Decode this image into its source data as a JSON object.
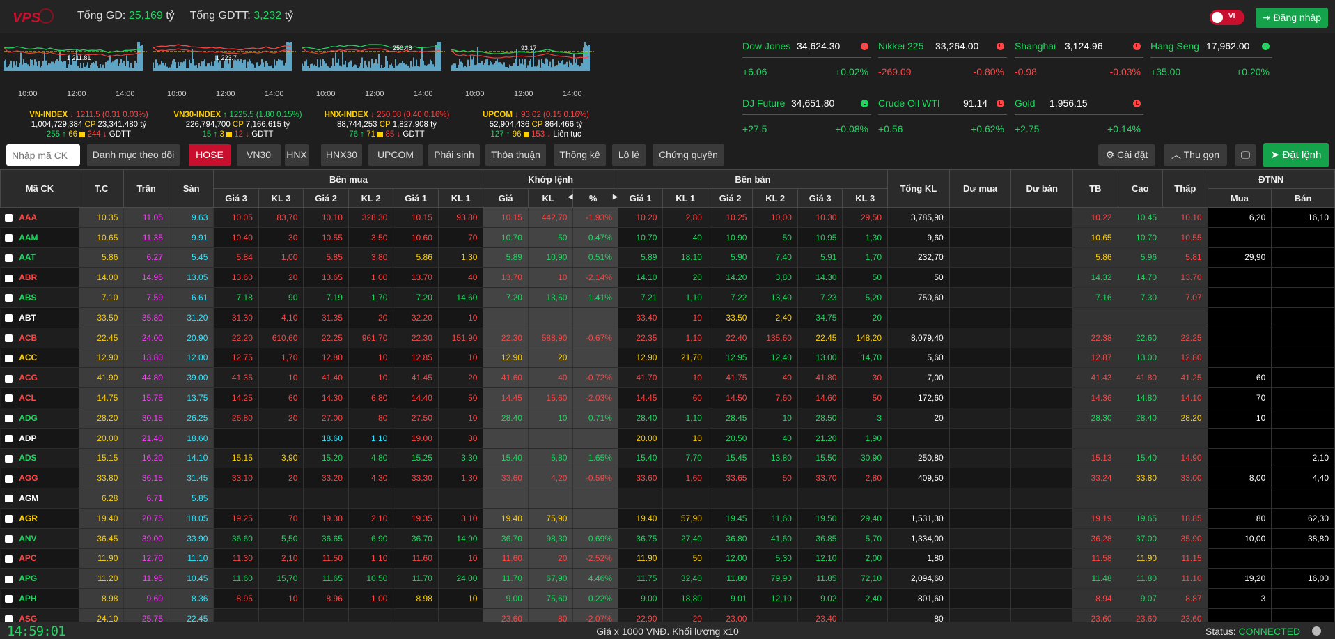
{
  "header": {
    "logo_text": "VPS",
    "total_gd_label": "Tổng GD:",
    "total_gd_value": "25,169",
    "total_gd_unit": "tỷ",
    "total_gdtt_label": "Tổng GDTT:",
    "total_gdtt_value": "3,232",
    "total_gdtt_unit": "tỷ",
    "lang_label": "VI",
    "login_label": "Đăng nhập"
  },
  "indices": [
    {
      "name": "VN-INDEX",
      "value": "1211.5",
      "change": "(0.31  0.03%)",
      "volume": "1,004,729,384",
      "cp_value": "23,341.480 tỷ",
      "up": "255",
      "ref": "66",
      "down": "244",
      "tail": "GDTT",
      "ref_label": "1 211.81",
      "dir": "down",
      "times": [
        "10:00",
        "12:00",
        "14:00"
      ]
    },
    {
      "name": "VN30-INDEX",
      "value": "1225.5",
      "change": "(1.80  0.15%)",
      "volume": "226,794,700",
      "cp_value": "7,166.615 tỷ",
      "up": "15",
      "ref": "3",
      "down": "12",
      "tail": "GDTT",
      "ref_label": "1 223.7",
      "dir": "up",
      "times": [
        "10:00",
        "12:00",
        "14:00"
      ]
    },
    {
      "name": "HNX-INDEX",
      "value": "250.08",
      "change": "(0.40  0.16%)",
      "volume": "88,744,253",
      "cp_value": "1,827.908 tỷ",
      "up": "76",
      "ref": "71",
      "down": "85",
      "tail": "GDTT",
      "ref_label": "250.48",
      "dir": "down",
      "times": [
        "10:00",
        "12:00",
        "14:00"
      ]
    },
    {
      "name": "UPCOM",
      "value": "93.02",
      "change": "(0.15  0.16%)",
      "volume": "52,904,436",
      "cp_value": "864.466 tỷ",
      "up": "127",
      "ref": "96",
      "down": "153",
      "tail": "Liên tục",
      "ref_label": "93.17",
      "dir": "down",
      "times": [
        "10:00",
        "12:00",
        "14:00"
      ]
    }
  ],
  "world": [
    {
      "name": "Dow Jones",
      "value": "34,624.30",
      "change": "+6.06",
      "pct": "+0.02%",
      "color": "#1ed760",
      "clock": "#ff4545"
    },
    {
      "name": "Nikkei 225",
      "value": "33,264.00",
      "change": "-269.09",
      "pct": "-0.80%",
      "color": "#ff4545",
      "clock": "#ff4545"
    },
    {
      "name": "Shanghai",
      "value": "3,124.96",
      "change": "-0.98",
      "pct": "-0.03%",
      "color": "#ff4545",
      "clock": "#ff4545"
    },
    {
      "name": "Hang Seng",
      "value": "17,962.00",
      "change": "+35.00",
      "pct": "+0.20%",
      "color": "#1ed760",
      "clock": "#1ed760"
    },
    {
      "name": "DJ Future",
      "value": "34,651.80",
      "change": "+27.5",
      "pct": "+0.08%",
      "color": "#1ed760",
      "clock": "#1ed760"
    },
    {
      "name": "Crude Oil WTI",
      "value": "91.14",
      "change": "+0.56",
      "pct": "+0.62%",
      "color": "#1ed760",
      "clock": "#ff4545"
    },
    {
      "name": "Gold",
      "value": "1,956.15",
      "change": "+2.75",
      "pct": "+0.14%",
      "color": "#1ed760",
      "clock": "#ff4545"
    }
  ],
  "toolbar": {
    "search_placeholder": "Nhập mã CK",
    "tabs": [
      "Danh mục theo dõi",
      "HOSE",
      "VN30",
      "HNX",
      "HNX30",
      "UPCOM",
      "Phái sinh",
      "Thỏa thuận",
      "Thống kê",
      "Lô lẻ",
      "Chứng quyền"
    ],
    "active_tab": "HOSE",
    "settings_label": "Cài đặt",
    "collapse_label": "Thu gọn",
    "order_label": "Đặt lệnh"
  },
  "table": {
    "group_headers": {
      "buy": "Bên mua",
      "match": "Khớp lệnh",
      "sell": "Bên bán",
      "foreign": "ĐTNN"
    },
    "headers": {
      "symbol": "Mã CK",
      "ref": "T.C",
      "ceil": "Trần",
      "floor": "Sàn",
      "b3": "Giá 3",
      "bv3": "KL 3",
      "b2": "Giá 2",
      "bv2": "KL 2",
      "b1": "Giá 1",
      "bv1": "KL 1",
      "mp": "Giá",
      "mv": "KL",
      "pct": "%",
      "s1": "Giá 1",
      "sv1": "KL 1",
      "s2": "Giá 2",
      "sv2": "KL 2",
      "s3": "Giá 3",
      "sv3": "KL 3",
      "total": "Tổng KL",
      "dbuy": "Dư mua",
      "dsell": "Dư bán",
      "avg": "TB",
      "high": "Cao",
      "low": "Thấp",
      "fbuy": "Mua",
      "fsell": "Bán"
    },
    "rows": [
      {
        "s": "AAA",
        "r": "10.35",
        "c": "11.05",
        "f": "9.63",
        "b3": "10.05",
        "bv3": "83,70",
        "b2": "10.10",
        "bv2": "328,30",
        "b1": "10.15",
        "bv1": "93,80",
        "mp": "10.15",
        "mv": "442,70",
        "pct": "-1.93%",
        "s1": "10.20",
        "sv1": "2,80",
        "s2": "10.25",
        "sv2": "10,00",
        "s3": "10.30",
        "sv3": "29,50",
        "tot": "3,785,90",
        "db": "",
        "ds": "",
        "avg": "10.22",
        "hi": "10.45",
        "lo": "10.10",
        "fb": "6,20",
        "fs": "16,10"
      },
      {
        "s": "AAM",
        "r": "10.65",
        "c": "11.35",
        "f": "9.91",
        "b3": "10.40",
        "bv3": "30",
        "b2": "10.55",
        "bv2": "3,50",
        "b1": "10.60",
        "bv1": "70",
        "mp": "10.70",
        "mv": "50",
        "pct": "0.47%",
        "s1": "10.70",
        "sv1": "40",
        "s2": "10.90",
        "sv2": "50",
        "s3": "10.95",
        "sv3": "1,30",
        "tot": "9,60",
        "db": "",
        "ds": "",
        "avg": "10.65",
        "hi": "10.70",
        "lo": "10.55",
        "fb": "",
        "fs": ""
      },
      {
        "s": "AAT",
        "r": "5.86",
        "c": "6.27",
        "f": "5.45",
        "b3": "5.84",
        "bv3": "1,00",
        "b2": "5.85",
        "bv2": "3,80",
        "b1": "5.86",
        "bv1": "1,30",
        "mp": "5.89",
        "mv": "10,90",
        "pct": "0.51%",
        "s1": "5.89",
        "sv1": "18,10",
        "s2": "5.90",
        "sv2": "7,40",
        "s3": "5.91",
        "sv3": "1,70",
        "tot": "232,70",
        "db": "",
        "ds": "",
        "avg": "5.86",
        "hi": "5.96",
        "lo": "5.81",
        "fb": "29,90",
        "fs": ""
      },
      {
        "s": "ABR",
        "r": "14.00",
        "c": "14.95",
        "f": "13.05",
        "b3": "13.60",
        "bv3": "20",
        "b2": "13.65",
        "bv2": "1,00",
        "b1": "13.70",
        "bv1": "40",
        "mp": "13.70",
        "mv": "10",
        "pct": "-2.14%",
        "s1": "14.10",
        "sv1": "20",
        "s2": "14.20",
        "sv2": "3,80",
        "s3": "14.30",
        "sv3": "50",
        "tot": "50",
        "db": "",
        "ds": "",
        "avg": "14.32",
        "hi": "14.70",
        "lo": "13.70",
        "fb": "",
        "fs": ""
      },
      {
        "s": "ABS",
        "r": "7.10",
        "c": "7.59",
        "f": "6.61",
        "b3": "7.18",
        "bv3": "90",
        "b2": "7.19",
        "bv2": "1,70",
        "b1": "7.20",
        "bv1": "14,60",
        "mp": "7.20",
        "mv": "13,50",
        "pct": "1.41%",
        "s1": "7.21",
        "sv1": "1,10",
        "s2": "7.22",
        "sv2": "13,40",
        "s3": "7.23",
        "sv3": "5,20",
        "tot": "750,60",
        "db": "",
        "ds": "",
        "avg": "7.16",
        "hi": "7.30",
        "lo": "7.07",
        "fb": "",
        "fs": ""
      },
      {
        "s": "ABT",
        "r": "33.50",
        "c": "35.80",
        "f": "31.20",
        "b3": "31.30",
        "bv3": "4,10",
        "b2": "31.35",
        "bv2": "20",
        "b1": "32.20",
        "bv1": "10",
        "mp": "",
        "mv": "",
        "pct": "",
        "s1": "33.40",
        "sv1": "10",
        "s2": "33.50",
        "sv2": "2,40",
        "s3": "34.75",
        "sv3": "20",
        "tot": "",
        "db": "",
        "ds": "",
        "avg": "",
        "hi": "",
        "lo": "",
        "fb": "",
        "fs": ""
      },
      {
        "s": "ACB",
        "r": "22.45",
        "c": "24.00",
        "f": "20.90",
        "b3": "22.20",
        "bv3": "610,60",
        "b2": "22.25",
        "bv2": "961,70",
        "b1": "22.30",
        "bv1": "151,90",
        "mp": "22.30",
        "mv": "588,90",
        "pct": "-0.67%",
        "s1": "22.35",
        "sv1": "1,10",
        "s2": "22.40",
        "sv2": "135,60",
        "s3": "22.45",
        "sv3": "148,20",
        "tot": "8,079,40",
        "db": "",
        "ds": "",
        "avg": "22.38",
        "hi": "22.60",
        "lo": "22.25",
        "fb": "",
        "fs": ""
      },
      {
        "s": "ACC",
        "r": "12.90",
        "c": "13.80",
        "f": "12.00",
        "b3": "12.75",
        "bv3": "1,70",
        "b2": "12.80",
        "bv2": "10",
        "b1": "12.85",
        "bv1": "10",
        "mp": "12.90",
        "mv": "20",
        "pct": "",
        "s1": "12.90",
        "sv1": "21,70",
        "s2": "12.95",
        "sv2": "12,40",
        "s3": "13.00",
        "sv3": "14,70",
        "tot": "5,60",
        "db": "",
        "ds": "",
        "avg": "12.87",
        "hi": "13.00",
        "lo": "12.80",
        "fb": "",
        "fs": ""
      },
      {
        "s": "ACG",
        "r": "41.90",
        "c": "44.80",
        "f": "39.00",
        "b3": "41.35",
        "bv3": "10",
        "b2": "41.40",
        "bv2": "10",
        "b1": "41.45",
        "bv1": "20",
        "mp": "41.60",
        "mv": "40",
        "pct": "-0.72%",
        "s1": "41.70",
        "sv1": "10",
        "s2": "41.75",
        "sv2": "40",
        "s3": "41.80",
        "sv3": "30",
        "tot": "7,00",
        "db": "",
        "ds": "",
        "avg": "41.43",
        "hi": "41.80",
        "lo": "41.25",
        "fb": "60",
        "fs": ""
      },
      {
        "s": "ACL",
        "r": "14.75",
        "c": "15.75",
        "f": "13.75",
        "b3": "14.25",
        "bv3": "60",
        "b2": "14.30",
        "bv2": "6,80",
        "b1": "14.40",
        "bv1": "50",
        "mp": "14.45",
        "mv": "15,60",
        "pct": "-2.03%",
        "s1": "14.45",
        "sv1": "60",
        "s2": "14.50",
        "sv2": "7,60",
        "s3": "14.60",
        "sv3": "50",
        "tot": "172,60",
        "db": "",
        "ds": "",
        "avg": "14.36",
        "hi": "14.80",
        "lo": "14.10",
        "fb": "70",
        "fs": ""
      },
      {
        "s": "ADG",
        "r": "28.20",
        "c": "30.15",
        "f": "26.25",
        "b3": "26.80",
        "bv3": "20",
        "b2": "27.00",
        "bv2": "80",
        "b1": "27.50",
        "bv1": "10",
        "mp": "28.40",
        "mv": "10",
        "pct": "0.71%",
        "s1": "28.40",
        "sv1": "1,10",
        "s2": "28.45",
        "sv2": "10",
        "s3": "28.50",
        "sv3": "3",
        "tot": "20",
        "db": "",
        "ds": "",
        "avg": "28.30",
        "hi": "28.40",
        "lo": "28.20",
        "fb": "10",
        "fs": ""
      },
      {
        "s": "ADP",
        "r": "20.00",
        "c": "21.40",
        "f": "18.60",
        "b3": "",
        "bv3": "",
        "b2": "18.60",
        "bv2": "1,10",
        "b1": "19.00",
        "bv1": "30",
        "mp": "",
        "mv": "",
        "pct": "",
        "s1": "20.00",
        "sv1": "10",
        "s2": "20.50",
        "sv2": "40",
        "s3": "21.20",
        "sv3": "1,90",
        "tot": "",
        "db": "",
        "ds": "",
        "avg": "",
        "hi": "",
        "lo": "",
        "fb": "",
        "fs": ""
      },
      {
        "s": "ADS",
        "r": "15.15",
        "c": "16.20",
        "f": "14.10",
        "b3": "15.15",
        "bv3": "3,90",
        "b2": "15.20",
        "bv2": "4,80",
        "b1": "15.25",
        "bv1": "3,30",
        "mp": "15.40",
        "mv": "5,80",
        "pct": "1.65%",
        "s1": "15.40",
        "sv1": "7,70",
        "s2": "15.45",
        "sv2": "13,80",
        "s3": "15.50",
        "sv3": "30,90",
        "tot": "250,80",
        "db": "",
        "ds": "",
        "avg": "15.13",
        "hi": "15.40",
        "lo": "14.90",
        "fb": "",
        "fs": "2,10"
      },
      {
        "s": "AGG",
        "r": "33.80",
        "c": "36.15",
        "f": "31.45",
        "b3": "33.10",
        "bv3": "20",
        "b2": "33.20",
        "bv2": "4,30",
        "b1": "33.30",
        "bv1": "1,30",
        "mp": "33.60",
        "mv": "4,20",
        "pct": "-0.59%",
        "s1": "33.60",
        "sv1": "1,60",
        "s2": "33.65",
        "sv2": "50",
        "s3": "33.70",
        "sv3": "2,80",
        "tot": "409,50",
        "db": "",
        "ds": "",
        "avg": "33.24",
        "hi": "33.80",
        "lo": "33.00",
        "fb": "8,00",
        "fs": "4,40"
      },
      {
        "s": "AGM",
        "r": "6.28",
        "c": "6.71",
        "f": "5.85",
        "b3": "",
        "bv3": "",
        "b2": "",
        "bv2": "",
        "b1": "",
        "bv1": "",
        "mp": "",
        "mv": "",
        "pct": "",
        "s1": "",
        "sv1": "",
        "s2": "",
        "sv2": "",
        "s3": "",
        "sv3": "",
        "tot": "",
        "db": "",
        "ds": "",
        "avg": "",
        "hi": "",
        "lo": "",
        "fb": "",
        "fs": ""
      },
      {
        "s": "AGR",
        "r": "19.40",
        "c": "20.75",
        "f": "18.05",
        "b3": "19.25",
        "bv3": "70",
        "b2": "19.30",
        "bv2": "2,10",
        "b1": "19.35",
        "bv1": "3,10",
        "mp": "19.40",
        "mv": "75,90",
        "pct": "",
        "s1": "19.40",
        "sv1": "57,90",
        "s2": "19.45",
        "sv2": "11,60",
        "s3": "19.50",
        "sv3": "29,40",
        "tot": "1,531,30",
        "db": "",
        "ds": "",
        "avg": "19.19",
        "hi": "19.65",
        "lo": "18.85",
        "fb": "80",
        "fs": "62,30"
      },
      {
        "s": "ANV",
        "r": "36.45",
        "c": "39.00",
        "f": "33.90",
        "b3": "36.60",
        "bv3": "5,50",
        "b2": "36.65",
        "bv2": "6,90",
        "b1": "36.70",
        "bv1": "14,90",
        "mp": "36.70",
        "mv": "98,30",
        "pct": "0.69%",
        "s1": "36.75",
        "sv1": "27,40",
        "s2": "36.80",
        "sv2": "41,60",
        "s3": "36.85",
        "sv3": "5,70",
        "tot": "1,334,00",
        "db": "",
        "ds": "",
        "avg": "36.28",
        "hi": "37.00",
        "lo": "35.90",
        "fb": "10,00",
        "fs": "38,80"
      },
      {
        "s": "APC",
        "r": "11.90",
        "c": "12.70",
        "f": "11.10",
        "b3": "11.30",
        "bv3": "2,10",
        "b2": "11.50",
        "bv2": "1,10",
        "b1": "11.60",
        "bv1": "10",
        "mp": "11.60",
        "mv": "20",
        "pct": "-2.52%",
        "s1": "11.90",
        "sv1": "50",
        "s2": "12.00",
        "sv2": "5,30",
        "s3": "12.10",
        "sv3": "2,00",
        "tot": "1,80",
        "db": "",
        "ds": "",
        "avg": "11.58",
        "hi": "11.90",
        "lo": "11.15",
        "fb": "",
        "fs": ""
      },
      {
        "s": "APG",
        "r": "11.20",
        "c": "11.95",
        "f": "10.45",
        "b3": "11.60",
        "bv3": "15,70",
        "b2": "11.65",
        "bv2": "10,50",
        "b1": "11.70",
        "bv1": "24,00",
        "mp": "11.70",
        "mv": "67,90",
        "pct": "4.46%",
        "s1": "11.75",
        "sv1": "32,40",
        "s2": "11.80",
        "sv2": "79,90",
        "s3": "11.85",
        "sv3": "72,10",
        "tot": "2,094,60",
        "db": "",
        "ds": "",
        "avg": "11.48",
        "hi": "11.80",
        "lo": "11.10",
        "fb": "19,20",
        "fs": "16,00"
      },
      {
        "s": "APH",
        "r": "8.98",
        "c": "9.60",
        "f": "8.36",
        "b3": "8.95",
        "bv3": "10",
        "b2": "8.96",
        "bv2": "1,00",
        "b1": "8.98",
        "bv1": "10",
        "mp": "9.00",
        "mv": "75,60",
        "pct": "0.22%",
        "s1": "9.00",
        "sv1": "18,80",
        "s2": "9.01",
        "sv2": "12,10",
        "s3": "9.02",
        "sv3": "2,40",
        "tot": "801,60",
        "db": "",
        "ds": "",
        "avg": "8.94",
        "hi": "9.07",
        "lo": "8.87",
        "fb": "3",
        "fs": ""
      },
      {
        "s": "ASG",
        "r": "24.10",
        "c": "25.75",
        "f": "22.45",
        "b3": "",
        "bv3": "",
        "b2": "",
        "bv2": "",
        "b1": "",
        "bv1": "",
        "mp": "23.60",
        "mv": "80",
        "pct": "-2.07%",
        "s1": "22.90",
        "sv1": "20",
        "s2": "23.00",
        "sv2": "",
        "s3": "23.40",
        "sv3": "",
        "tot": "80",
        "db": "",
        "ds": "",
        "avg": "23.60",
        "hi": "23.60",
        "lo": "23.60",
        "fb": "",
        "fs": ""
      }
    ]
  },
  "footer": {
    "clock": "14:59:01",
    "note": "Giá x 1000 VNĐ. Khối lượng x10",
    "status_label": "Status:",
    "status_value": "CONNECTED"
  }
}
